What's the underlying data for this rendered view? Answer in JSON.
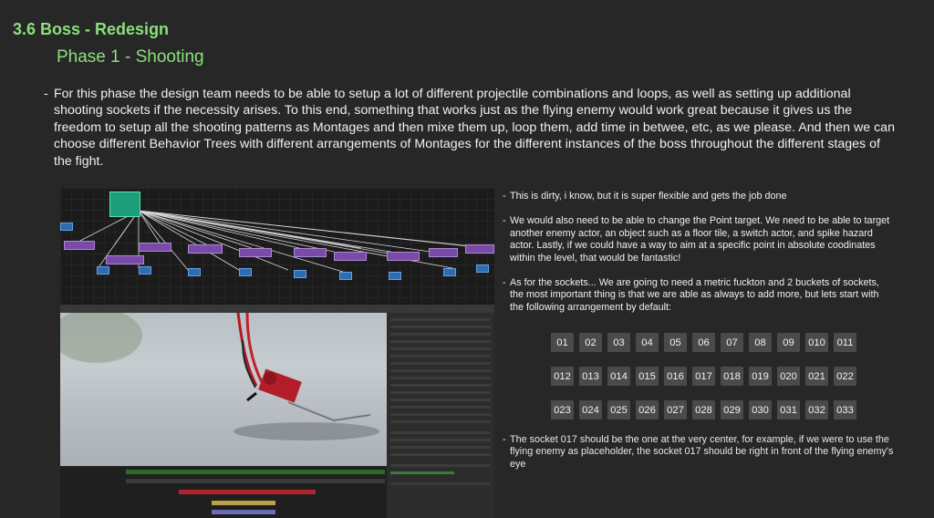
{
  "header": {
    "title": "3.6 Boss - Redesign",
    "subtitle": "Phase 1 - Shooting"
  },
  "intro": {
    "dash": "-",
    "text": "For this phase the design team needs to be able to setup a lot of different projectile combinations and loops, as well as setting up additional shooting sockets if the necessity arises. To this end, something that works just as the flying enemy would work great because it gives us the freedom to setup all the shooting patterns as Montages and then mixe them up, loop them, add time in betwee, etc, as we please. And then we can choose different Behavior Trees with different arrangements of Montages for the different instances of the boss throughout the different stages of the fight."
  },
  "notes": [
    "This is dirty, i know, but it is super flexible and gets the job done",
    "We would also need to be able to change the Point target. We need to be able to target another enemy actor, an object such as a floor tile, a switch actor, and spike hazard actor. Lastly, if we could have a way to aim at a specific point in absolute coodinates within the level, that would be fantastic!",
    "As for the sockets... We are going to need a metric fuckton and 2 buckets of sockets, the most important thing is that we are able as always to add more, but lets start with the following arrangement by default:"
  ],
  "sockets": [
    [
      "01",
      "02",
      "03",
      "04",
      "05",
      "06",
      "07",
      "08",
      "09",
      "010",
      "011"
    ],
    [
      "012",
      "013",
      "014",
      "015",
      "016",
      "017",
      "018",
      "019",
      "020",
      "021",
      "022"
    ],
    [
      "023",
      "024",
      "025",
      "026",
      "027",
      "028",
      "029",
      "030",
      "031",
      "032",
      "033"
    ]
  ],
  "final_note": "The socket 017 should be the one at the very center, for example, if we were to use the flying enemy as placeholder, the socket 017 should be right in front of the flying enemy's eye"
}
